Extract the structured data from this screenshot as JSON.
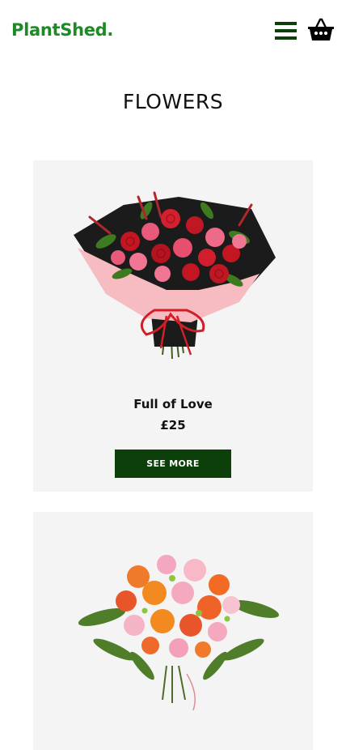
{
  "header": {
    "logo": "PlantShed.",
    "menu_icon": "hamburger-menu-icon",
    "cart_icon": "basket-icon"
  },
  "page": {
    "title": "FLOWERS"
  },
  "products": [
    {
      "name": "Full of Love",
      "price": "£25",
      "button_label": "SEE MORE",
      "image": "red-pink-rose-bouquet"
    },
    {
      "name": "",
      "price": "",
      "button_label": "",
      "image": "orange-pink-mixed-bouquet"
    }
  ],
  "colors": {
    "brand_green": "#1e8a25",
    "dark_green": "#0d3f0b",
    "card_bg": "#f4f4f4"
  }
}
